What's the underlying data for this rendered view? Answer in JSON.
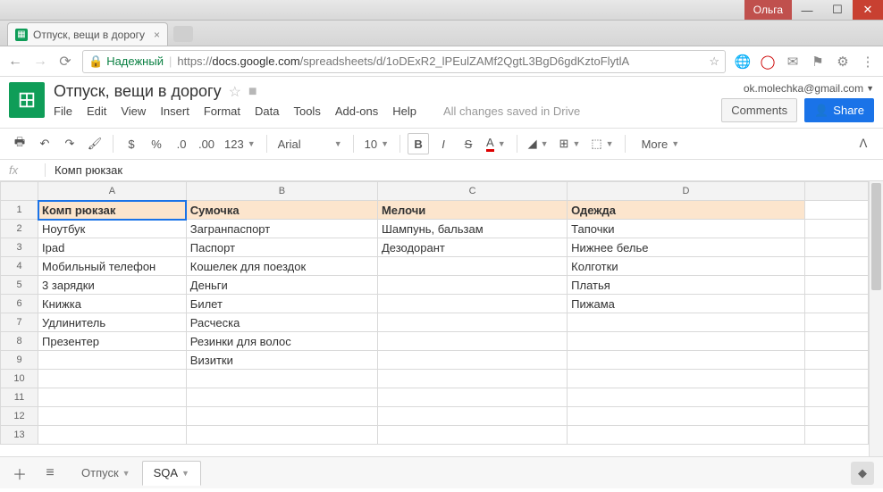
{
  "window": {
    "user": "Ольга"
  },
  "tab": {
    "title": "Отпуск, вещи в дорогу"
  },
  "url": {
    "secure_label": "Надежный",
    "scheme": "https://",
    "host": "docs.google.com",
    "path": "/spreadsheets/d/1oDExR2_lPEulZAMf2QgtL3BgD6gdKztoFlytlA"
  },
  "doc": {
    "title": "Отпуск, вещи в дорогу",
    "status": "All changes saved in Drive",
    "email": "ok.molechka@gmail.com",
    "comments": "Comments",
    "share": "Share"
  },
  "menu": [
    "File",
    "Edit",
    "View",
    "Insert",
    "Format",
    "Data",
    "Tools",
    "Add-ons",
    "Help"
  ],
  "toolbar": {
    "font": "Arial",
    "size": "10",
    "numfmt": "123",
    "more": "More"
  },
  "fx": {
    "value": "Комп рюкзак"
  },
  "columns": [
    "A",
    "B",
    "C",
    "D"
  ],
  "rows": [
    {
      "n": 1,
      "header": true,
      "cells": [
        "Комп рюкзак",
        "Сумочка",
        "Мелочи",
        "Одежда"
      ]
    },
    {
      "n": 2,
      "cells": [
        "Ноутбук",
        "Загранпаспорт",
        "Шампунь, бальзам",
        "Тапочки"
      ]
    },
    {
      "n": 3,
      "cells": [
        "Ipad",
        "Паспорт",
        "Дезодорант",
        "Нижнее белье"
      ]
    },
    {
      "n": 4,
      "cells": [
        "Мобильный телефон",
        "Кошелек для поездок",
        "",
        "Колготки"
      ]
    },
    {
      "n": 5,
      "cells": [
        "3 зарядки",
        "Деньги",
        "",
        "Платья"
      ]
    },
    {
      "n": 6,
      "cells": [
        "Книжка",
        "Билет",
        "",
        "Пижама"
      ]
    },
    {
      "n": 7,
      "cells": [
        "Удлинитель",
        "Расческа",
        "",
        ""
      ]
    },
    {
      "n": 8,
      "cells": [
        "Презентер",
        "Резинки для волос",
        "",
        ""
      ]
    },
    {
      "n": 9,
      "cells": [
        "",
        "Визитки",
        "",
        ""
      ]
    },
    {
      "n": 10,
      "cells": [
        "",
        "",
        "",
        ""
      ]
    },
    {
      "n": 11,
      "cells": [
        "",
        "",
        "",
        ""
      ]
    },
    {
      "n": 12,
      "cells": [
        "",
        "",
        "",
        ""
      ]
    },
    {
      "n": 13,
      "cells": [
        "",
        "",
        "",
        ""
      ]
    }
  ],
  "selected": {
    "row": 1,
    "col": 0
  },
  "sheets": [
    {
      "name": "Отпуск",
      "active": false
    },
    {
      "name": "SQA",
      "active": true
    }
  ]
}
